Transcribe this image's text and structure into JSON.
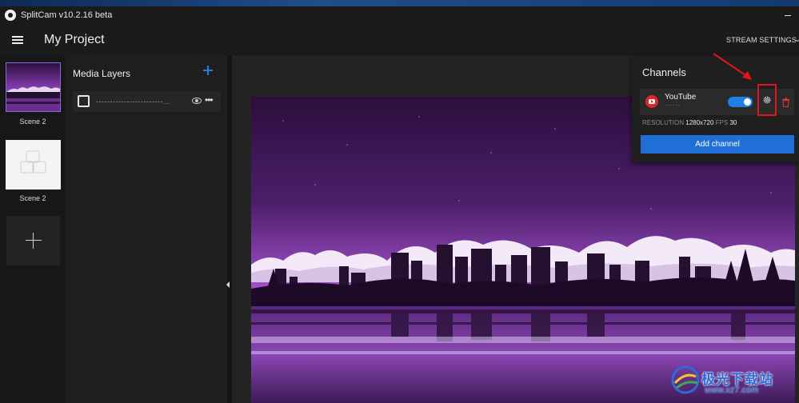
{
  "window": {
    "title": "SplitCam v10.2.16 beta"
  },
  "header": {
    "project_title": "My Project",
    "stream_settings_label": "STREAM SETTINGS"
  },
  "scenes": {
    "items": [
      {
        "label": "Scene 2"
      },
      {
        "label": "Scene 2"
      }
    ]
  },
  "media_layers": {
    "title": "Media Layers",
    "layers": [
      {
        "name": "------------------------..."
      }
    ]
  },
  "channels": {
    "title": "Channels",
    "items": [
      {
        "name": "YouTube",
        "sub": "------",
        "enabled": true
      }
    ],
    "resolution_label": "RESOLUTION",
    "resolution_value": "1280x720",
    "fps_label": "FPS",
    "fps_value": "30",
    "add_label": "Add channel"
  },
  "colors": {
    "accent": "#1f7fe5",
    "highlight": "#e0141b",
    "preview_sky": "#3a1a52",
    "preview_glow": "#9a4cc0"
  },
  "watermark": {
    "text": "极光下载站",
    "url": "www.xz7.com"
  }
}
